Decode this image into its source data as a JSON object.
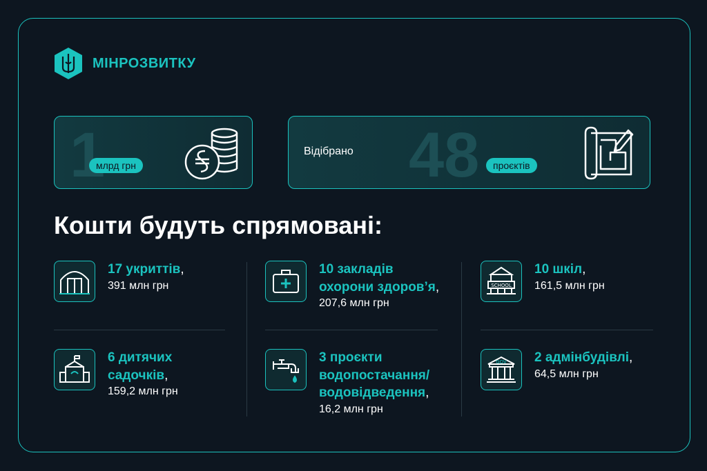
{
  "brand": {
    "name": "МІНРОЗВИТКУ"
  },
  "stats": {
    "funding": {
      "number": "1",
      "unit": "млрд грн",
      "icon": "coins-hryvnia-icon"
    },
    "projects": {
      "label": "Відібрано",
      "number": "48",
      "unit": "проєктів",
      "icon": "blueprint-icon"
    }
  },
  "heading": "Кошти будуть спрямовані:",
  "items": [
    {
      "title": "17 укриттів",
      "comma": ",",
      "sub": "391 млн грн",
      "icon": "shelter-icon"
    },
    {
      "title_line1": "10 закладів",
      "title_line2": "охорони здоров’я",
      "comma": ",",
      "sub": "207,6 млн грн",
      "icon": "first-aid-kit-icon"
    },
    {
      "title": "10 шкіл",
      "comma": ",",
      "sub": "161,5 млн грн",
      "icon": "school-icon"
    },
    {
      "title_line1": "6 дитячих",
      "title_line2": "садочків",
      "comma": ",",
      "sub": "159,2 млн грн",
      "icon": "kindergarten-icon"
    },
    {
      "title_line1": "3 проєкти",
      "title_line2": "водопостачання/",
      "title_line3": "водовідведення",
      "comma": ",",
      "sub": "16,2 млн грн",
      "icon": "water-tap-icon"
    },
    {
      "title": "2 адмінбудівлі",
      "comma": ",",
      "sub": "64,5 млн грн",
      "icon": "gov-building-icon"
    }
  ],
  "colors": {
    "accent": "#1bc3bf",
    "background": "#0d1620",
    "big_number": "#1d4f55"
  }
}
